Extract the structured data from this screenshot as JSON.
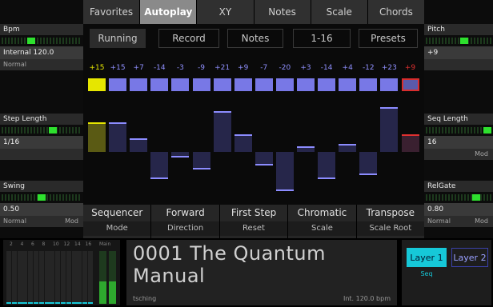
{
  "tabs": [
    "Favorites",
    "Autoplay",
    "XY",
    "Notes",
    "Scale",
    "Chords"
  ],
  "toolbar": {
    "running": "Running",
    "record": "Record",
    "notes": "Notes",
    "range": "1-16",
    "presets": "Presets"
  },
  "left_panel": {
    "bpm": {
      "label": "Bpm",
      "value": "Internal 120.0",
      "sub": "Normal",
      "meter": 0.35
    },
    "step_length": {
      "label": "Step Length",
      "value": "1/16",
      "meter": 0.65
    },
    "swing": {
      "label": "Swing",
      "value": "0.50",
      "sub": "Normal",
      "mod": "Mod",
      "meter": 0.5
    }
  },
  "right_panel": {
    "pitch": {
      "label": "Pitch",
      "value": "+9",
      "meter": 0.6
    },
    "seq_length": {
      "label": "Seq Length",
      "value": "16",
      "mod": "Mod",
      "meter": 1.0
    },
    "relgate": {
      "label": "RelGate",
      "value": "0.80",
      "sub": "Normal",
      "mod": "Mod",
      "meter": 0.8
    }
  },
  "steps": {
    "labels": [
      "+15",
      "+15",
      "+7",
      "-14",
      "-3",
      "-9",
      "+21",
      "+9",
      "-7",
      "-20",
      "+3",
      "-14",
      "+4",
      "-12",
      "+23",
      "+9"
    ],
    "values": [
      15,
      15,
      7,
      -14,
      -3,
      -9,
      21,
      9,
      -7,
      -20,
      3,
      -14,
      4,
      -12,
      23,
      9
    ],
    "colors": {
      "first": "#e6e600",
      "normal": "#9090ff",
      "last": "#e03030"
    }
  },
  "actions": [
    {
      "top": "Sequencer",
      "bottom": "Mode"
    },
    {
      "top": "Forward",
      "bottom": "Direction"
    },
    {
      "top": "First Step",
      "bottom": "Reset"
    },
    {
      "top": "Chromatic",
      "bottom": "Scale"
    },
    {
      "top": "Transpose",
      "bottom": "Scale Root"
    }
  ],
  "mixer": {
    "labels": [
      "2",
      "4",
      "6",
      "8",
      "10",
      "12",
      "14",
      "16",
      "Main"
    ]
  },
  "project": {
    "name": "0001 The Quantum Manual",
    "author": "tsching",
    "clock": "Int. 120.0 bpm"
  },
  "layers": {
    "layer1": "Layer 1",
    "layer2": "Layer 2",
    "tag": "Seq"
  }
}
